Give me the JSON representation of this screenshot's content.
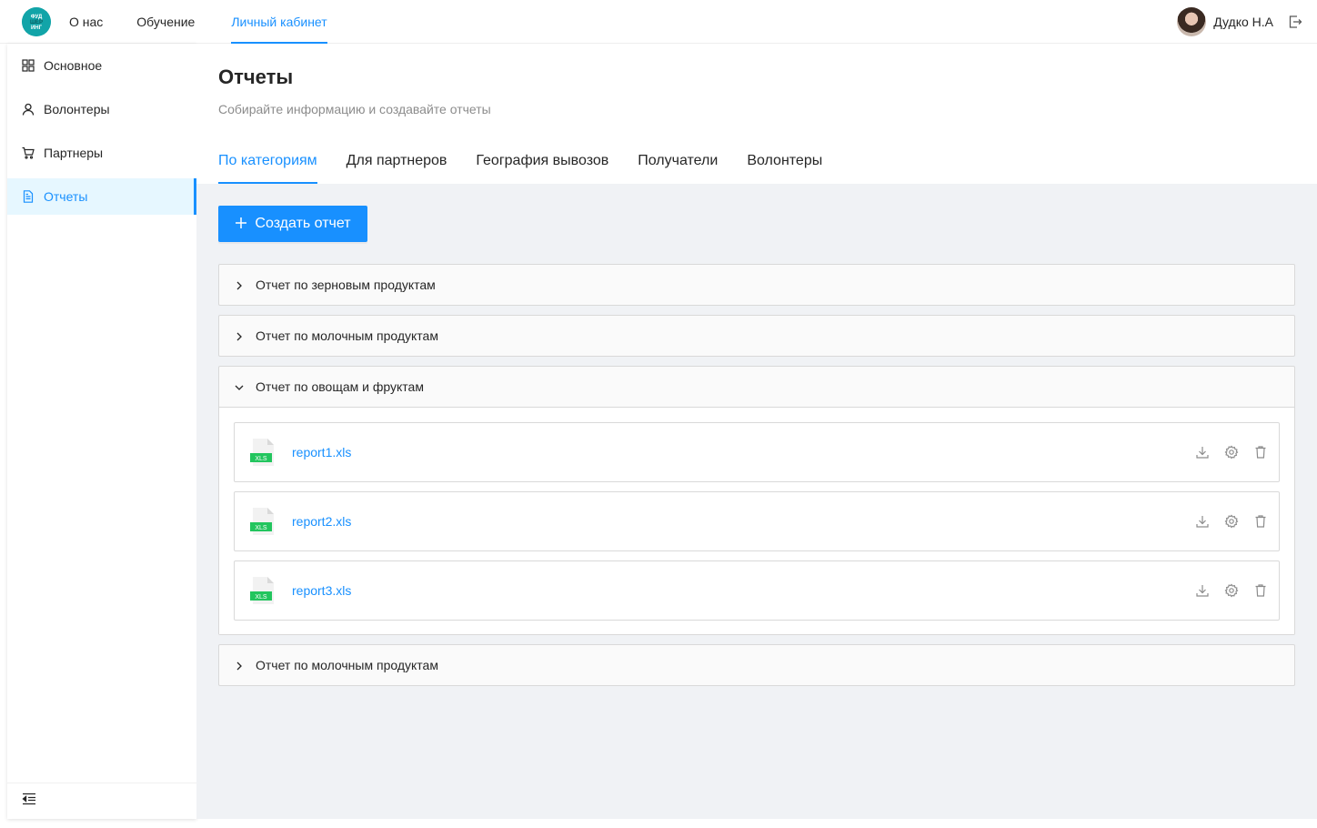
{
  "logo": {
    "text": "ФУД ШЕР ИНГ"
  },
  "topnav": [
    {
      "label": "О нас",
      "active": false
    },
    {
      "label": "Обучение",
      "active": false
    },
    {
      "label": "Личный кабинет",
      "active": true
    }
  ],
  "user": {
    "name": "Дудко Н.А"
  },
  "sidebar": {
    "items": [
      {
        "label": "Основное",
        "icon": "dashboard-icon",
        "active": false
      },
      {
        "label": "Волонтеры",
        "icon": "user-icon",
        "active": false
      },
      {
        "label": "Партнеры",
        "icon": "cart-icon",
        "active": false
      },
      {
        "label": "Отчеты",
        "icon": "file-icon",
        "active": true
      }
    ]
  },
  "page": {
    "title": "Отчеты",
    "subtitle": "Собирайте  информацию и создавайте отчеты"
  },
  "tabs": [
    {
      "label": "По категориям",
      "active": true
    },
    {
      "label": "Для партнеров",
      "active": false
    },
    {
      "label": "География вывозов",
      "active": false
    },
    {
      "label": "Получатели",
      "active": false
    },
    {
      "label": "Волонтеры",
      "active": false
    }
  ],
  "create_button": {
    "label": "Создать отчет"
  },
  "panels": [
    {
      "title": "Отчет по зерновым продуктам",
      "expanded": false
    },
    {
      "title": "Отчет по молочным продуктам",
      "expanded": false
    },
    {
      "title": "Отчет по овощам и фруктам",
      "expanded": true,
      "files": [
        {
          "name": "report1.xls",
          "badge": "XLS"
        },
        {
          "name": "report2.xls",
          "badge": "XLS"
        },
        {
          "name": "report3.xls",
          "badge": "XLS"
        }
      ]
    },
    {
      "title": "Отчет по молочным продуктам",
      "expanded": false
    }
  ],
  "colors": {
    "accent": "#1890ff",
    "logo": "#12a4a8",
    "xls": "#22c55e"
  }
}
